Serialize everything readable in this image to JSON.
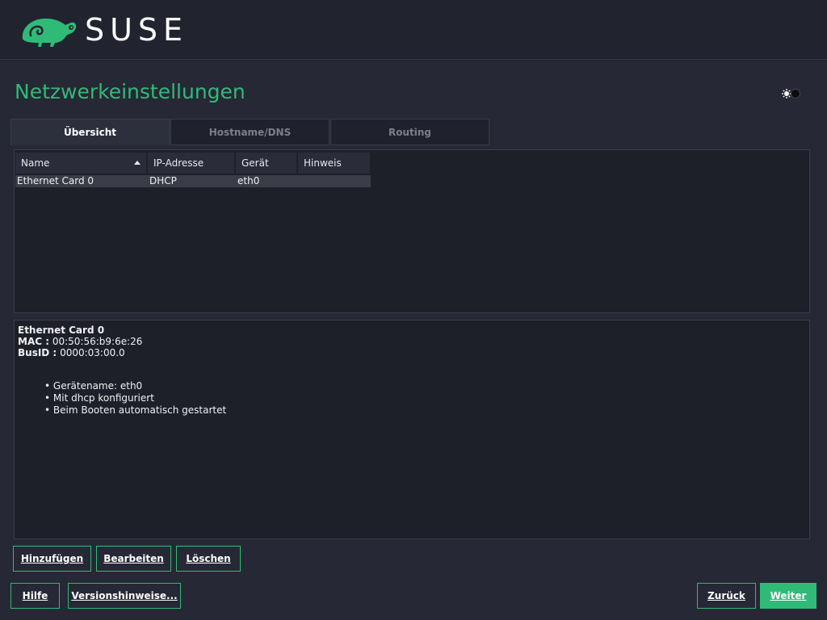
{
  "header": {
    "brand": "SUSE",
    "logo_icon": "chameleon-icon"
  },
  "page": {
    "title": "Netzwerkeinstellungen",
    "theme_toggle_icon": "theme-toggle-icon"
  },
  "tabs": [
    {
      "label": "Übersicht",
      "active": true
    },
    {
      "label": "Hostname/DNS",
      "active": false
    },
    {
      "label": "Routing",
      "active": false
    }
  ],
  "table": {
    "columns": [
      "Name",
      "IP-Adresse",
      "Gerät",
      "Hinweis"
    ],
    "sort_icon": "sort-ascending-icon",
    "rows": [
      [
        "Ethernet Card 0",
        "DHCP",
        "eth0",
        ""
      ]
    ]
  },
  "details": {
    "title": "Ethernet Card 0",
    "mac_label": "MAC :",
    "mac_value": "00:50:56:b9:6e:26",
    "busid_label": "BusID :",
    "busid_value": "0000:03:00.0",
    "items": [
      "Gerätename: eth0",
      "Mit dhcp konfiguriert",
      "Beim Booten automatisch gestartet"
    ]
  },
  "actions": {
    "add": "Hinzufügen",
    "edit": "Bearbeiten",
    "delete": "Löschen"
  },
  "footer": {
    "help": "Hilfe",
    "release_notes": "Versionshinweise...",
    "back": "Zurück",
    "next": "Weiter"
  },
  "colors": {
    "accent": "#30ba78",
    "background": "#262835",
    "header": "#21232f"
  }
}
